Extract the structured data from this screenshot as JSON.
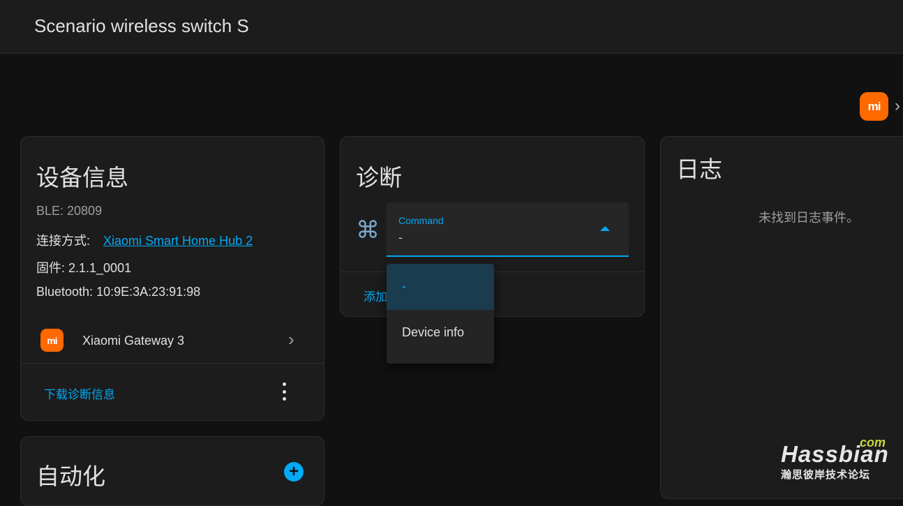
{
  "header": {
    "title": "Scenario wireless switch S"
  },
  "brand": {
    "logo_text": "mi",
    "next_symbol": "›"
  },
  "device_info": {
    "title": "设备信息",
    "model": "BLE: 20809",
    "connection_label": "连接方式:",
    "connection_link": "Xiaomi Smart Home Hub 2",
    "firmware": "固件: 2.1.1_0001",
    "bluetooth": "Bluetooth: 10:9E:3A:23:91:98",
    "gateway": {
      "logo_text": "mi",
      "label": "Xiaomi Gateway 3",
      "chevron": "›"
    },
    "action": "下载诊断信息"
  },
  "automation": {
    "title": "自动化",
    "add_symbol": "+"
  },
  "diagnostics": {
    "title": "诊断",
    "command_icon": "⌘",
    "select": {
      "label": "Command",
      "value": "-"
    },
    "action": "添加",
    "options": [
      "-",
      "Device info"
    ],
    "selected_index": 0
  },
  "logbook": {
    "title": "日志",
    "empty": "未找到日志事件。"
  },
  "watermark": {
    "com": "com",
    "main": "Hassbian",
    "sub": "瀚思彼岸技术论坛"
  },
  "colors": {
    "accent": "#03a9f4",
    "brand": "#ff6900",
    "background": "#111111",
    "card": "#1c1c1c"
  }
}
